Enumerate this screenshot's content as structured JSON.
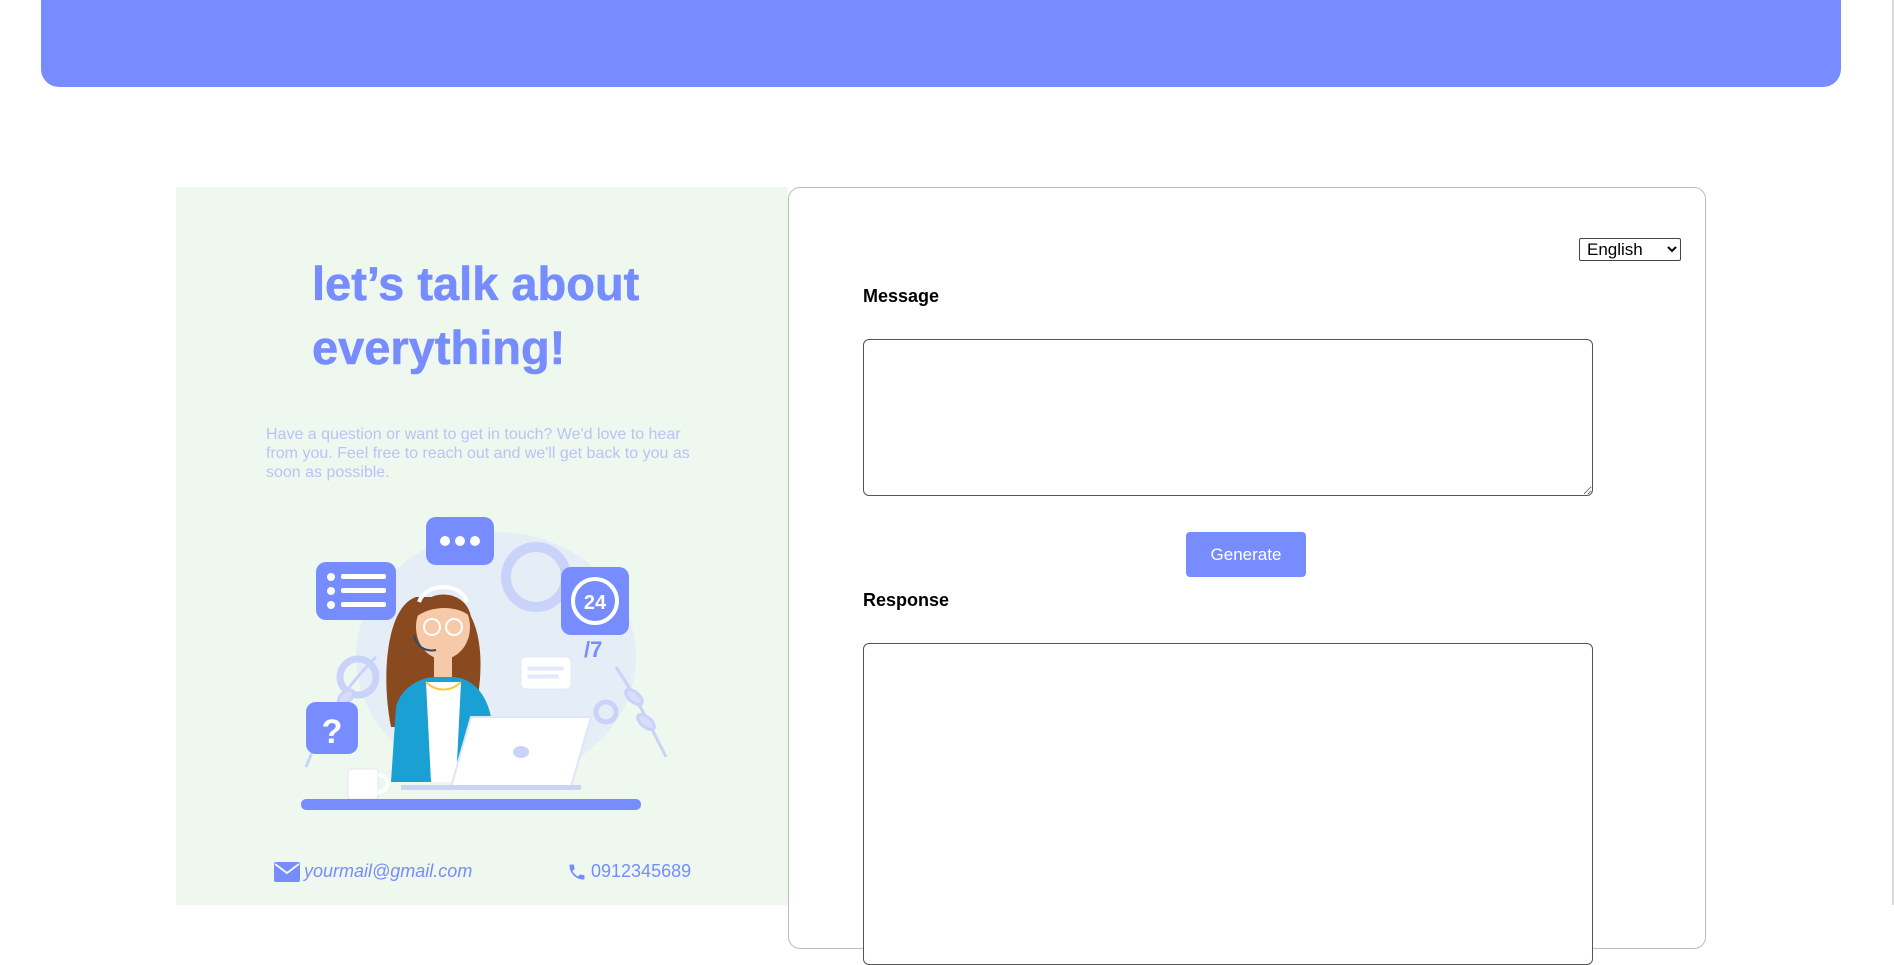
{
  "colors": {
    "accent": "#768cff",
    "panel_bg": "#eef8ee",
    "intro_text": "#b9c3f5"
  },
  "hero": {
    "headline": "let’s talk about everything!",
    "intro": "Have a question or want to get in touch? We'd love to hear from you. Feel free to reach out and we'll get back to you as soon as possible."
  },
  "contact": {
    "email": "yourmail@gmail.com",
    "email_icon": "envelope-icon",
    "phone": "0912345689",
    "phone_icon": "phone-icon"
  },
  "form": {
    "language": {
      "selected": "English",
      "options": [
        "English"
      ]
    },
    "message_label": "Message",
    "message_value": "",
    "generate_label": "Generate",
    "response_label": "Response",
    "response_value": ""
  }
}
